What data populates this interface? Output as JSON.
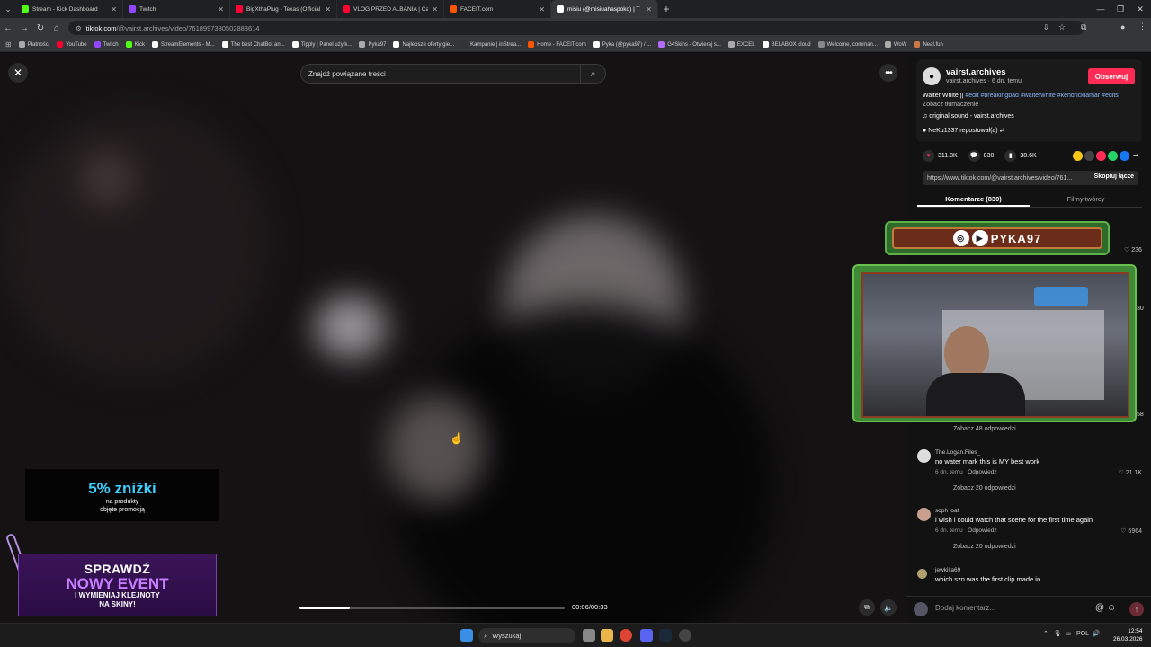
{
  "browser": {
    "tabs": [
      {
        "label": "Stream - Kick Dashboard",
        "color": "#53fc18"
      },
      {
        "label": "Twitch",
        "color": "#9146ff"
      },
      {
        "label": "BigXthaPlug - Texas (Official M",
        "color": "#ff0033"
      },
      {
        "label": "VLOG PRZED ALBANIA | Cały vi",
        "color": "#ff0033"
      },
      {
        "label": "FACEIT.com",
        "color": "#ff5500"
      },
      {
        "label": "misiu (@misiuahaspoko) | T",
        "color": "#ffffff"
      }
    ],
    "url_host": "tiktok.com",
    "url_path": "/@vairst.archives/video/7618997380502883614",
    "bookmarks": [
      {
        "label": "Płatności",
        "color": "#aaaaaa"
      },
      {
        "label": "YouTube",
        "color": "#ff0033"
      },
      {
        "label": "Twitch",
        "color": "#9146ff"
      },
      {
        "label": "Kick",
        "color": "#53fc18"
      },
      {
        "label": "StreamElements - M...",
        "color": "#ffffff"
      },
      {
        "label": "The best ChatBot an...",
        "color": "#ffffff"
      },
      {
        "label": "Tipply | Panel użytk...",
        "color": "#ffffff"
      },
      {
        "label": "Pyka97",
        "color": "#aaaaaa"
      },
      {
        "label": "Najlepsze oferty gie...",
        "color": "#ffffff"
      },
      {
        "label": "Kampanie | inStrea...",
        "color": "#333333"
      },
      {
        "label": "Home - FACEIT.com",
        "color": "#ff5500"
      },
      {
        "label": "Pyka (@pyka97) / ...",
        "color": "#ffffff"
      },
      {
        "label": "G4Skins - Otwieraj s...",
        "color": "#b46cff"
      },
      {
        "label": "EXCEL",
        "color": "#aaaaaa"
      },
      {
        "label": "BELABOX cloud",
        "color": "#ffffff"
      },
      {
        "label": "Welcome, comman...",
        "color": "#888888"
      },
      {
        "label": "WoW",
        "color": "#aaaaaa"
      },
      {
        "label": "Neal.fun",
        "color": "#cc7744"
      }
    ]
  },
  "video": {
    "search_placeholder": "Znajdź powiązane treści",
    "time": "00:06/00:33",
    "progress": 0.19
  },
  "promo": {
    "discount_big": "5% zniżki",
    "discount_small1": "na produkty",
    "discount_small2": "objęte promocją",
    "event_l1": "SPRAWDŹ",
    "event_l2": "NOWY EVENT",
    "event_l3": "I WYMIENIAJ KLEJNOTY",
    "event_l4": "NA SKINY!"
  },
  "author": {
    "name": "vairst.archives",
    "sub": "vairst.archives · 6 dn. temu",
    "follow": "Obserwuj",
    "desc_text": "Walter White || ",
    "desc_tags": "#edit #breakingbad #walterwhite #kendricklamar #edits",
    "translate": "Zobacz tłumaczenie",
    "sound": "original sound - vairst.archives",
    "repost": "NeKu1337 repostował(a)"
  },
  "stats": {
    "likes": "311.8K",
    "comments": "830",
    "saves": "38.6K"
  },
  "share_colors": [
    "#f5c518",
    "#444444",
    "#fe2c55",
    "#25d366",
    "#1877f2"
  ],
  "link": {
    "url": "https://www.tiktok.com/@vairst.archives/video/761...",
    "copy": "Skopiuj łącze"
  },
  "panel_tabs": [
    "Komentarze (830)",
    "Filmy twórcy"
  ],
  "overlay": {
    "banner": "PYKA97"
  },
  "comments": {
    "top_like": "236",
    "side1": "30",
    "side2": "58",
    "more48": "Zobacz 48 odpowiedzi",
    "c1": {
      "user": "The.Logan.Files_",
      "text": "no water mark this is MY best work",
      "meta": "6 dn. temu",
      "reply": "Odpowiedz",
      "likes": "21.1K",
      "more": "Zobacz 20 odpowiedzi"
    },
    "c2": {
      "user": "soph loaf",
      "text": "i wish i could watch that scene for the first time again",
      "meta": "6 dn. temu",
      "reply": "Odpowiedz",
      "likes": "6964",
      "more": "Zobacz 20 odpowiedzi"
    },
    "c3": {
      "user": "jewkilla69",
      "text": "which szn was the first clip made in"
    }
  },
  "comment_input": "Dodaj komentarz...",
  "taskbar": {
    "search": "Wyszukaj",
    "lang": "POL",
    "time": "12:54",
    "date": "26.03.2026"
  }
}
